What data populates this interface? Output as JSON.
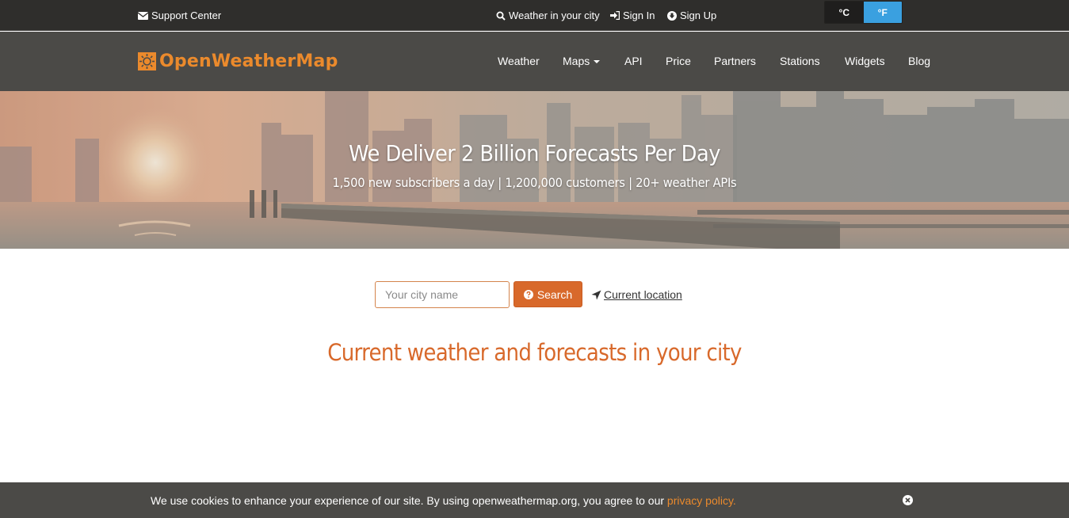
{
  "topbar": {
    "support_label": "Support Center",
    "weather_city_label": "Weather in your city",
    "sign_in_label": "Sign In",
    "sign_up_label": "Sign Up",
    "units": {
      "celsius": "°C",
      "fahrenheit": "°F",
      "selected": "°F"
    }
  },
  "brand": {
    "name": "OpenWeatherMap",
    "color": "#eb8a2c"
  },
  "nav": {
    "items": [
      {
        "label": "Weather"
      },
      {
        "label": "Maps",
        "has_dropdown": true
      },
      {
        "label": "API"
      },
      {
        "label": "Price"
      },
      {
        "label": "Partners"
      },
      {
        "label": "Stations"
      },
      {
        "label": "Widgets"
      },
      {
        "label": "Blog"
      }
    ]
  },
  "hero": {
    "title": "We Deliver 2 Billion Forecasts Per Day",
    "subtitle": "1,500 new subscribers a day | 1,200,000 customers | 20+ weather APIs"
  },
  "search": {
    "placeholder": "Your city name",
    "button_label": "Search",
    "current_location_label": " Current location"
  },
  "main": {
    "headline": "Current weather and forecasts in your city"
  },
  "cookie": {
    "text": "We use cookies to enhance your experience of our site. By using openweathermap.org, you agree to our ",
    "link_label": "privacy policy."
  },
  "colors": {
    "accent": "#d8692b",
    "topbar_bg": "#2f2e2c",
    "nav_bg": "#4b4a47",
    "unit_active": "#3aa0e0"
  },
  "icons": [
    "envelope-icon",
    "search-icon",
    "sign-in-icon",
    "sign-up-icon",
    "sun-logo-icon",
    "question-circle-icon",
    "location-arrow-icon",
    "close-circle-icon"
  ]
}
